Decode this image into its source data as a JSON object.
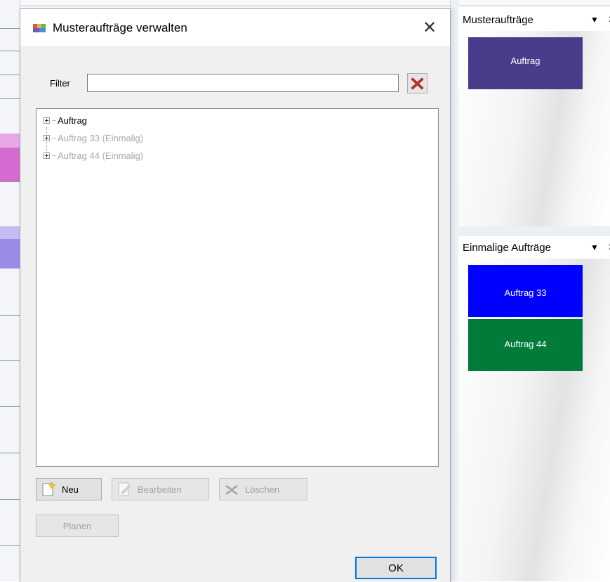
{
  "dialog": {
    "title": "Musteraufträge verwalten",
    "close_glyph": "✕",
    "filter": {
      "label": "Filter",
      "value": "",
      "placeholder": ""
    },
    "tree": {
      "items": [
        {
          "label": "Auftrag",
          "state": "normal"
        },
        {
          "label": "Auftrag 33 (Einmalig)",
          "state": "muted"
        },
        {
          "label": "Auftrag 44 (Einmalig)",
          "state": "muted"
        }
      ]
    },
    "buttons": {
      "new": "Neu",
      "edit": "Bearbeiten",
      "delete": "Löschen",
      "plan": "Planen",
      "ok": "OK"
    },
    "icons": {
      "app": "app-palette-icon",
      "clear": "red-x-clear-icon",
      "new": "new-item-sparkle-icon",
      "edit": "edit-document-icon",
      "delete": "delete-x-icon"
    }
  },
  "panels": {
    "templates": {
      "title": "Musteraufträge",
      "tiles": [
        {
          "label": "Auftrag",
          "color": "#483d8b"
        }
      ]
    },
    "one_time": {
      "title": "Einmalige Aufträge",
      "tiles": [
        {
          "label": "Auftrag 33",
          "color": "#0000ff"
        },
        {
          "label": "Auftrag 44",
          "color": "#007b3a"
        }
      ]
    },
    "dropdown_glyph": "▼",
    "close_glyph": "✕"
  },
  "colors": {
    "focus_accent": "#0078d7",
    "bg_block_magenta": "#d96fd1",
    "bg_block_violet": "#9e8de6"
  }
}
